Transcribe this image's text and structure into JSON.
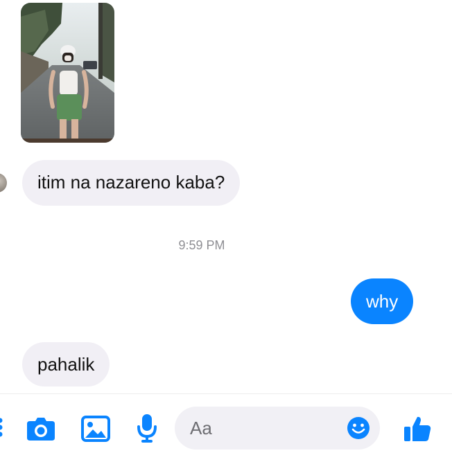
{
  "conversation": {
    "messages": [
      {
        "direction": "incoming",
        "type": "photo",
        "description_icon": "photo-attachment-icon"
      },
      {
        "direction": "incoming",
        "type": "text",
        "text": "itim na nazareno kaba?"
      },
      {
        "direction": "timestamp",
        "text": "9:59 PM"
      },
      {
        "direction": "outgoing",
        "type": "text",
        "text": "why"
      },
      {
        "direction": "incoming",
        "type": "text",
        "text": "pahalik"
      }
    ]
  },
  "composer": {
    "placeholder": "Aa",
    "buttons": [
      "more-icon",
      "camera-icon",
      "gallery-icon",
      "microphone-icon",
      "emoji-icon",
      "thumbs-up-icon"
    ]
  },
  "colors": {
    "accent": "#0a84ff",
    "incoming_bubble": "#f1eff5",
    "timestamp": "#8e8e93",
    "background": "#ffffff"
  }
}
